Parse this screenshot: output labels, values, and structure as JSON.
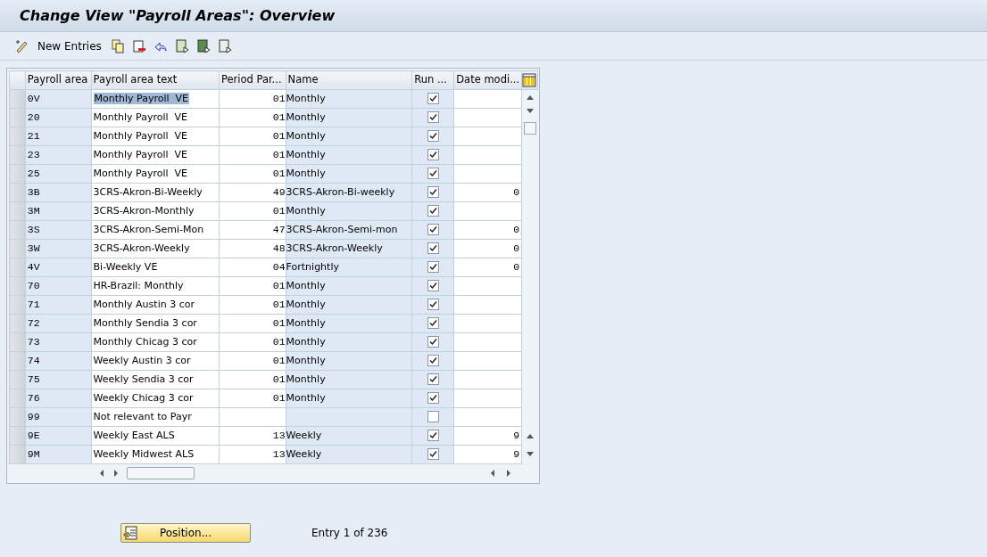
{
  "window": {
    "title": "Change View \"Payroll Areas\": Overview"
  },
  "toolbar": {
    "new_entries": "New Entries"
  },
  "table": {
    "columns": [
      "Payroll area",
      "Payroll area text",
      "Period Par...",
      "Name",
      "Run ...",
      "Date modi..."
    ],
    "rows": [
      {
        "area": "0V",
        "text": "Monthly Payroll  VE",
        "period": "01",
        "name": "Monthly",
        "run": true,
        "date": "",
        "highlighted": true
      },
      {
        "area": "20",
        "text": "Monthly Payroll  VE",
        "period": "01",
        "name": "Monthly",
        "run": true,
        "date": "",
        "highlighted": false
      },
      {
        "area": "21",
        "text": "Monthly Payroll  VE",
        "period": "01",
        "name": "Monthly",
        "run": true,
        "date": "",
        "highlighted": false
      },
      {
        "area": "23",
        "text": "Monthly Payroll  VE",
        "period": "01",
        "name": "Monthly",
        "run": true,
        "date": "",
        "highlighted": false
      },
      {
        "area": "25",
        "text": "Monthly Payroll  VE",
        "period": "01",
        "name": "Monthly",
        "run": true,
        "date": "",
        "highlighted": false
      },
      {
        "area": "3B",
        "text": "3CRS-Akron-Bi-Weekly",
        "period": "49",
        "name": "3CRS-Akron-Bi-weekly",
        "run": true,
        "date": "0",
        "highlighted": false
      },
      {
        "area": "3M",
        "text": "3CRS-Akron-Monthly",
        "period": "01",
        "name": "Monthly",
        "run": true,
        "date": "",
        "highlighted": false
      },
      {
        "area": "3S",
        "text": "3CRS-Akron-Semi-Mon",
        "period": "47",
        "name": "3CRS-Akron-Semi-mon",
        "run": true,
        "date": "0",
        "highlighted": false
      },
      {
        "area": "3W",
        "text": "3CRS-Akron-Weekly",
        "period": "48",
        "name": "3CRS-Akron-Weekly",
        "run": true,
        "date": "0",
        "highlighted": false
      },
      {
        "area": "4V",
        "text": "Bi-Weekly VE",
        "period": "04",
        "name": "Fortnightly",
        "run": true,
        "date": "0",
        "highlighted": false
      },
      {
        "area": "70",
        "text": "HR-Brazil: Monthly",
        "period": "01",
        "name": "Monthly",
        "run": true,
        "date": "",
        "highlighted": false
      },
      {
        "area": "71",
        "text": "Monthly Austin 3 cor",
        "period": "01",
        "name": "Monthly",
        "run": true,
        "date": "",
        "highlighted": false
      },
      {
        "area": "72",
        "text": "Monthly Sendia 3 cor",
        "period": "01",
        "name": "Monthly",
        "run": true,
        "date": "",
        "highlighted": false
      },
      {
        "area": "73",
        "text": "Monthly Chicag 3 cor",
        "period": "01",
        "name": "Monthly",
        "run": true,
        "date": "",
        "highlighted": false
      },
      {
        "area": "74",
        "text": "Weekly Austin 3 cor",
        "period": "01",
        "name": "Monthly",
        "run": true,
        "date": "",
        "highlighted": false
      },
      {
        "area": "75",
        "text": "Weekly Sendia 3 cor",
        "period": "01",
        "name": "Monthly",
        "run": true,
        "date": "",
        "highlighted": false
      },
      {
        "area": "76",
        "text": "Weekly Chicag 3 cor",
        "period": "01",
        "name": "Monthly",
        "run": true,
        "date": "",
        "highlighted": false
      },
      {
        "area": "99",
        "text": "Not relevant to Payr",
        "period": "",
        "name": "",
        "run": false,
        "date": "",
        "highlighted": false
      },
      {
        "area": "9E",
        "text": "Weekly East ALS",
        "period": "13",
        "name": "Weekly",
        "run": true,
        "date": "9",
        "highlighted": false
      },
      {
        "area": "9M",
        "text": "Weekly Midwest ALS",
        "period": "13",
        "name": "Weekly",
        "run": true,
        "date": "9",
        "highlighted": false
      }
    ]
  },
  "position_button": "Position...",
  "entry_info": "Entry 1 of 236"
}
